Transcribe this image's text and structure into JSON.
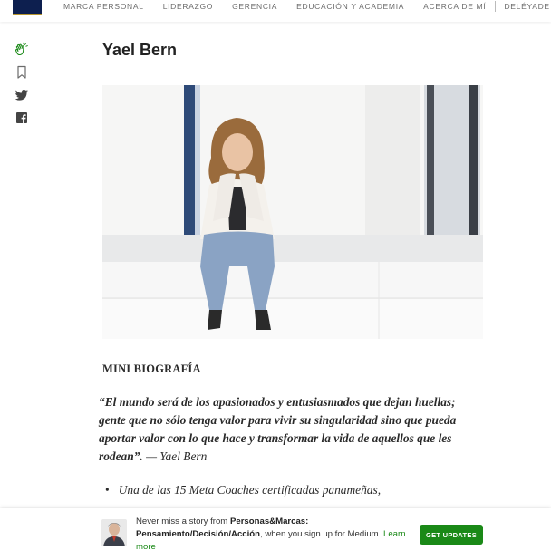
{
  "nav": {
    "items": [
      "MARCA PERSONAL",
      "LIDERAZGO",
      "GERENCIA",
      "EDUCACIÓN Y ACADEMIA",
      "ACERCA DE MÍ",
      "DELÉYADE"
    ]
  },
  "rail": {
    "icons": [
      "clap-icon",
      "bookmark-icon",
      "twitter-icon",
      "facebook-icon"
    ],
    "clap_color": "#1a8917"
  },
  "article": {
    "author_heading": "Yael Bern",
    "section_title": "MINI BIOGRAFÍA",
    "quote_text": "“El mundo será de los apasionados y entusiasmados que dejan huellas; gente que no sólo tenga valor para vivir su singularidad sino que pueda aportar valor con lo que hace y transformar la vida de aquellos que les rodean”.",
    "quote_attribution": " — Yael Bern",
    "bullet_1": "Una de las 15 Meta Coaches certificadas panameñas,"
  },
  "banner": {
    "prefix": "Never miss a story from ",
    "publication": "Personas&Marcas: Pensamiento/Decisión/Acción",
    "suffix": ", when you sign up for Medium. ",
    "learn_more": "Learn more",
    "cta_label": "GET UPDATES",
    "accent_color": "#1a8917"
  }
}
